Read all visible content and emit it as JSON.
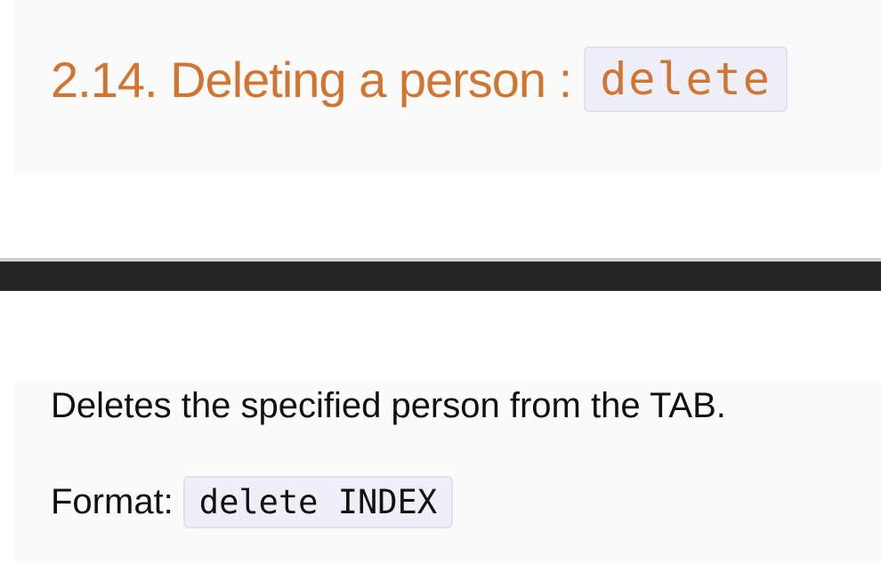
{
  "section": {
    "heading": {
      "text": "2.14. Deleting a person :",
      "code": "delete"
    }
  },
  "content": {
    "description": "Deletes the specified person from the TAB.",
    "format": {
      "label": "Format:",
      "code": "delete INDEX"
    }
  },
  "colors": {
    "heading": "#d07532",
    "code_background": "#efeffa",
    "divider": "#252525",
    "panel_background": "#fbfbfb"
  }
}
